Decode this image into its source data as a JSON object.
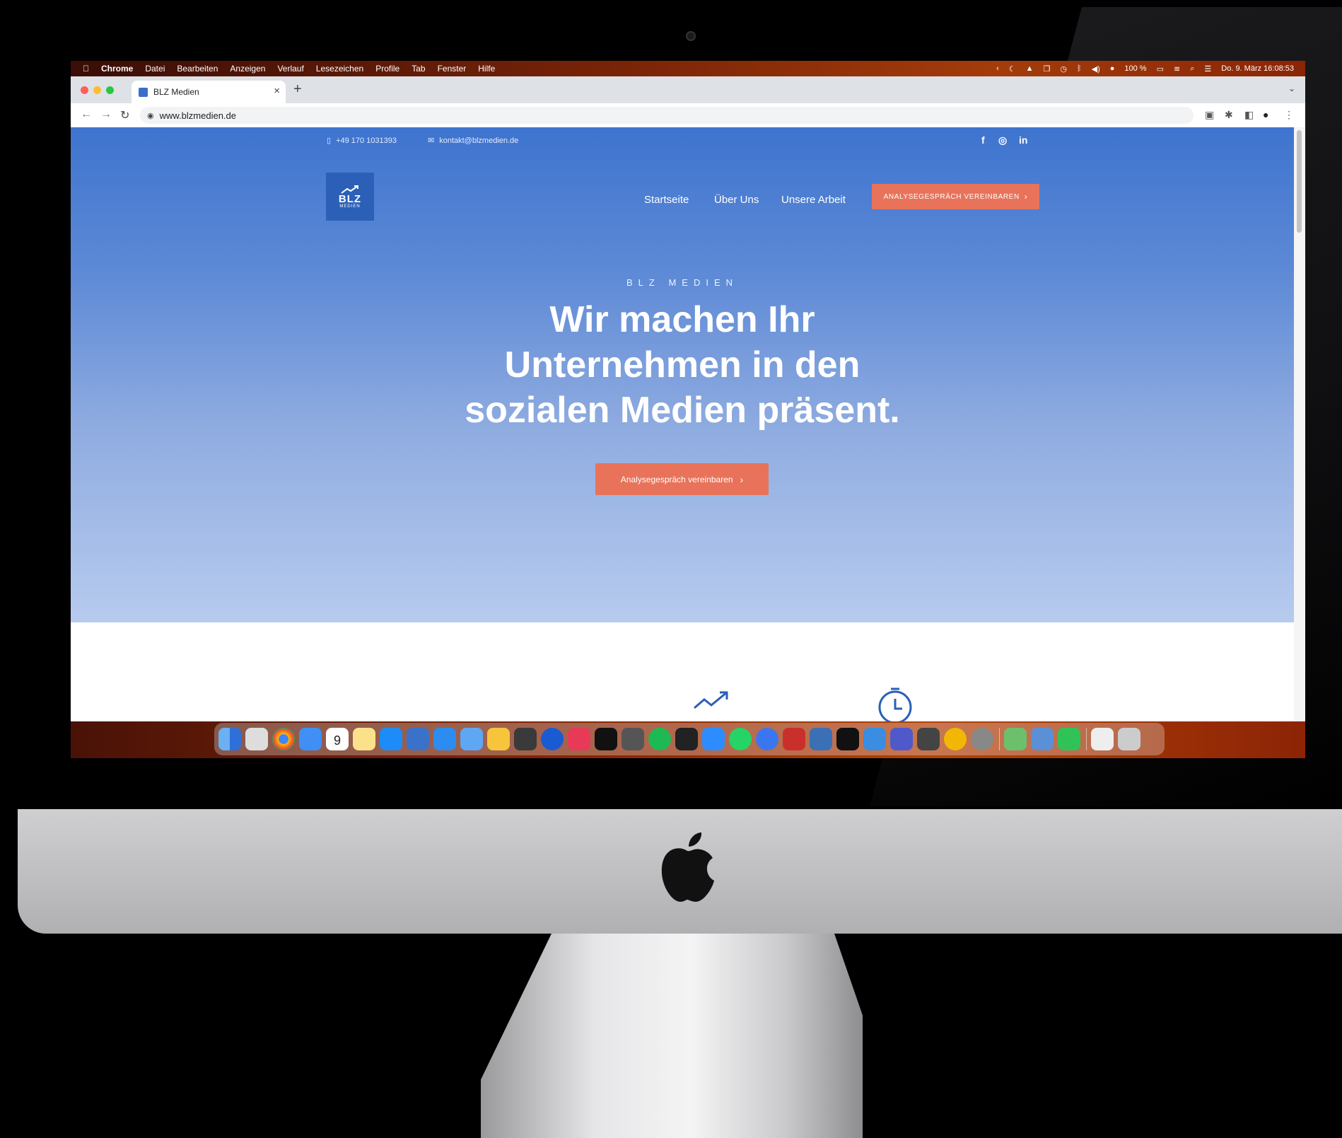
{
  "menubar": {
    "apple_icon": "apple-icon",
    "app_name": "Chrome",
    "items": [
      "Datei",
      "Bearbeiten",
      "Anzeigen",
      "Verlauf",
      "Lesezeichen",
      "Profile",
      "Tab",
      "Fenster",
      "Hilfe"
    ],
    "battery": "100 %",
    "datetime": "Do. 9. März  16:08:53"
  },
  "browser": {
    "tab_title": "BLZ Medien",
    "url": "www.blzmedien.de"
  },
  "site": {
    "phone": "+49 170 1031393",
    "email": "kontakt@blzmedien.de",
    "social": [
      "f",
      "◎",
      "in"
    ],
    "logo_main": "BLZ",
    "logo_sub": "MEDIEN",
    "nav": [
      "Startseite",
      "Über Uns",
      "Unsere Arbeit"
    ],
    "cta_top": "ANALYSEGESPRÄCH VEREINBAREN",
    "eyebrow": "BLZ MEDIEN",
    "headline_line1": "Wir machen Ihr",
    "headline_line2": "Unternehmen in den",
    "headline_line3": "sozialen Medien präsent.",
    "cta_main": "Analysegespräch vereinbaren",
    "colors": {
      "hero_top": "#3e74cf",
      "hero_bottom": "#b7cbee",
      "accent": "#e8735a"
    }
  },
  "dock": {
    "apps": [
      "finder",
      "launchpad",
      "chrome",
      "mail",
      "calendar",
      "notes",
      "app-store",
      "xcode",
      "pencil",
      "preview",
      "cyberduck",
      "sublime",
      "1password",
      "creative-cloud",
      "intellij",
      "final-cut",
      "spotify",
      "terminal",
      "zoom",
      "whatsapp",
      "signal",
      "sequel",
      "preview-2",
      "activity",
      "remote-desktop",
      "teams",
      "tablet",
      "amphetamine",
      "system-settings",
      "maps",
      "screen-sharing",
      "facetime",
      "print",
      "trash"
    ],
    "date_badge": "9"
  }
}
